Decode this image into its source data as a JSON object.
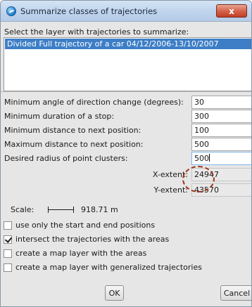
{
  "window": {
    "title": "Summarize classes of trajectories",
    "close_label": "x"
  },
  "layer_section": {
    "label": "Select the layer with trajectories to summarize:",
    "items": [
      {
        "label": "Divided Full trajectory of a car 04/12/2006-13/10/2007",
        "selected": true
      }
    ]
  },
  "params": [
    {
      "label": "Minimum angle of direction change (degrees):",
      "value": "30"
    },
    {
      "label": "Minimum duration of a stop:",
      "value": "300"
    },
    {
      "label": "Minimum distance to next position:",
      "value": "100"
    },
    {
      "label": "Maximum distance to next position:",
      "value": "500"
    },
    {
      "label": "Desired radius of point clusters:",
      "value": "500"
    }
  ],
  "extents": [
    {
      "label": "X-extent:",
      "value": "24947"
    },
    {
      "label": "Y-extent:",
      "value": "43570"
    }
  ],
  "scale": {
    "label": "Scale:",
    "value": "918.71 m"
  },
  "options": [
    {
      "label": "use only the start and end positions",
      "checked": false
    },
    {
      "label": "intersect the trajectories with the areas",
      "checked": true
    },
    {
      "label": "create a map layer with the areas",
      "checked": false
    },
    {
      "label": "create a map layer with generalized trajectories",
      "checked": false
    }
  ],
  "buttons": {
    "ok": "OK",
    "cancel": "Cancel"
  },
  "colors": {
    "selection": "#3d7ec6",
    "close_button": "#c13f24",
    "annotation_circle": "#a0361c"
  }
}
